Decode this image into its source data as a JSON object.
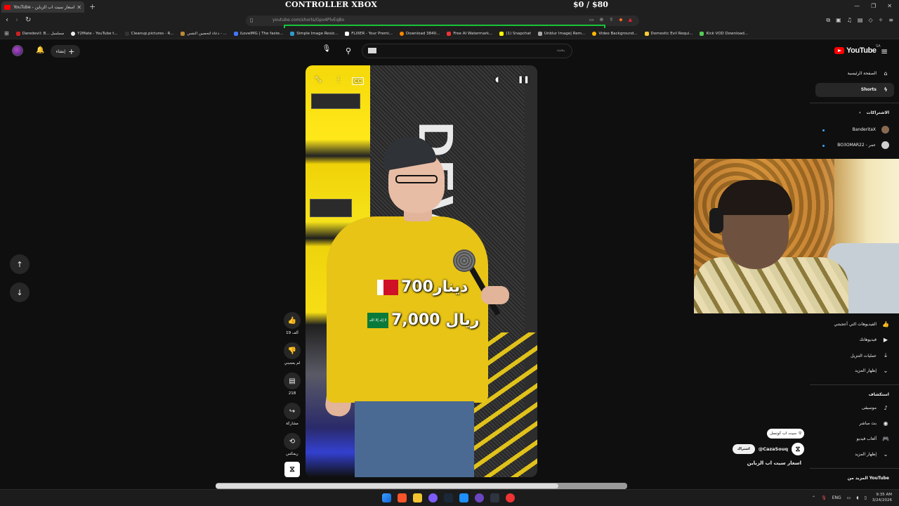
{
  "browser": {
    "tab_title": "اسعار سيت اب الزباين - YouTube",
    "url": "youtube.com/shorts/Gpo4PlvEqBo",
    "bookmarks": [
      "Daredevil: B... مسلسل",
      "Y2Mate - YouTube t...",
      "Cleanup.pictures - R...",
      "دعاء لتحصين النفس - ...",
      "iLoveIMG | The faste...",
      "Simple Image Resiz...",
      "FLIXER - Your Premi...",
      "Download 3840...",
      "Free AI Watermark...",
      "(1) Snapchat",
      "Unblur Image| Rem...",
      "Video Background...",
      "Domestic Evil Requi...",
      "Kick VOD Download..."
    ]
  },
  "stream_overlay": {
    "title": "CONTROLLER XBOX",
    "goal": "$0   / $80"
  },
  "youtube": {
    "logo_text": "YouTube",
    "region": "SA",
    "search_placeholder": "بحث",
    "create_label": "إنشاء",
    "sidebar": {
      "home": "الصفحة الرئيسية",
      "shorts": "Shorts",
      "subscriptions": "الاشتراكات",
      "channels": [
        {
          "name": "BanderitaX",
          "color": "#8a6a50"
        },
        {
          "name": "BO3OMAR22 - عمر",
          "color": "#cfcfcf"
        }
      ],
      "liked": "الفيديوهات التي أعجبتني",
      "your_videos": "فيديوهاتك",
      "downloads": "عمليات التنزيل",
      "show_more": "إظهار المزيد",
      "explore_heading": "استكشاف",
      "music": "موسيقى",
      "live": "بث مباشر",
      "gaming": "ألعاب فيديو",
      "show_more2": "إظهار المزيد",
      "more_from": "المزيد من YouTube"
    },
    "short": {
      "caption_line1": "700دينار",
      "caption_line2": "7,000 ريال",
      "flag_sa_text": "لا إله إلا الله",
      "likes": "19 ألف",
      "dislike": "لم يعجبني",
      "comments": "218",
      "share": "مشاركة",
      "remix": "ريمكس",
      "search_chip": "سيت اب كونسل",
      "channel": "@CazaSouq",
      "subscribe": "اشتراك",
      "title": "اسعار سيت اب الزباين"
    }
  },
  "taskbar": {
    "lang": "ENG",
    "time": "9:35 AM",
    "date": "3/24/2026"
  },
  "colors": {
    "accent_green": "#19c33a",
    "yt_red": "#ff0000"
  }
}
